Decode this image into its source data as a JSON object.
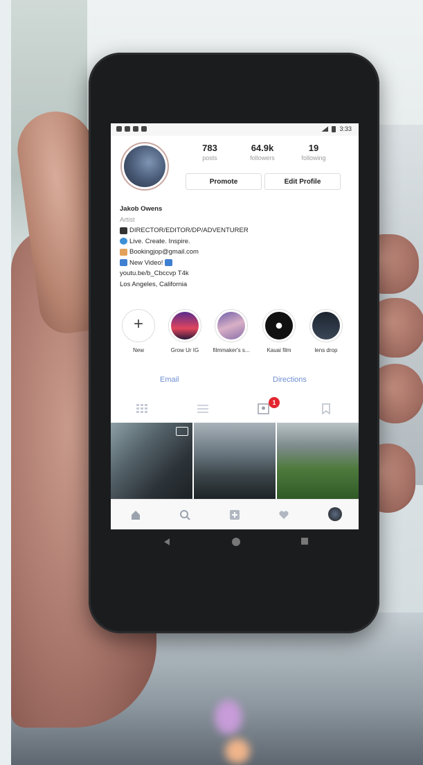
{
  "status_bar": {
    "time": "3:33"
  },
  "profile": {
    "stats": [
      {
        "value": "783",
        "label": "posts"
      },
      {
        "value": "64.9k",
        "label": "followers"
      },
      {
        "value": "19",
        "label": "following"
      }
    ],
    "promote_button": "Promote",
    "edit_profile_button": "Edit Profile",
    "name": "Jakob Owens",
    "category": "Artist",
    "bio_lines": [
      "DIRECTOR/EDITOR/DP/ADVENTURER",
      "Live. Create. Inspire.",
      "Bookingjop@gmail.com",
      "New Video!",
      "youtu.be/b_Cbccvp T4k",
      "Los Angeles, California"
    ]
  },
  "highlights": [
    {
      "label": "New"
    },
    {
      "label": "Grow Ur IG"
    },
    {
      "label": "filmmaker's s..."
    },
    {
      "label": "Kauai film"
    },
    {
      "label": "lens drop"
    }
  ],
  "links": {
    "email": "Email",
    "directions": "Directions"
  },
  "tabs": {
    "tagged_badge": "1"
  },
  "icons": [
    "grid-icon",
    "list-icon",
    "tagged-icon",
    "bookmark-icon",
    "home-icon",
    "search-icon",
    "add-post-icon",
    "heart-icon",
    "profile-icon"
  ],
  "colors": {
    "link": "#6f8fd2",
    "badge": "#e3262f"
  }
}
